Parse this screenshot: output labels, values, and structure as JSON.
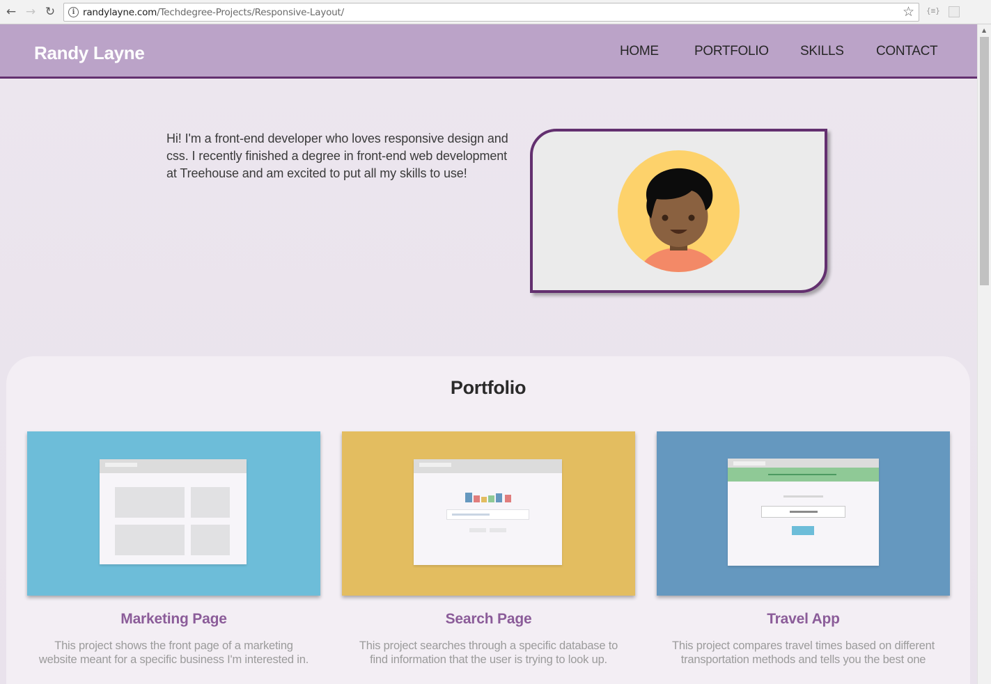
{
  "browser": {
    "url_host": "randylayne.com",
    "url_path": "/Techdegree-Projects/Responsive-Layout/",
    "ext_label": "{≡}"
  },
  "header": {
    "logo": "Randy Layne",
    "nav": [
      "HOME",
      "PORTFOLIO",
      "SKILLS",
      "CONTACT"
    ]
  },
  "intro": {
    "text": "Hi! I'm a front-end developer who loves responsive design and css. I recently finished a degree in front-end web development at Treehouse and am excited to put all my skills to use!"
  },
  "portfolio": {
    "title": "Portfolio",
    "items": [
      {
        "title": "Marketing Page",
        "description": "This project shows the front page of a marketing website meant for a specific business I'm interested in.",
        "color": "#6dbdd9"
      },
      {
        "title": "Search Page",
        "description": "This project searches through a specific database to find information that the user is trying to look up.",
        "color": "#e3bd60"
      },
      {
        "title": "Travel App",
        "description": "This project compares travel times based on different transportation methods and tells you the best one",
        "color": "#6598bf"
      }
    ]
  },
  "colors": {
    "header_bg": "#bba3c8",
    "accent": "#63306f",
    "card_title": "#8b5c99"
  }
}
